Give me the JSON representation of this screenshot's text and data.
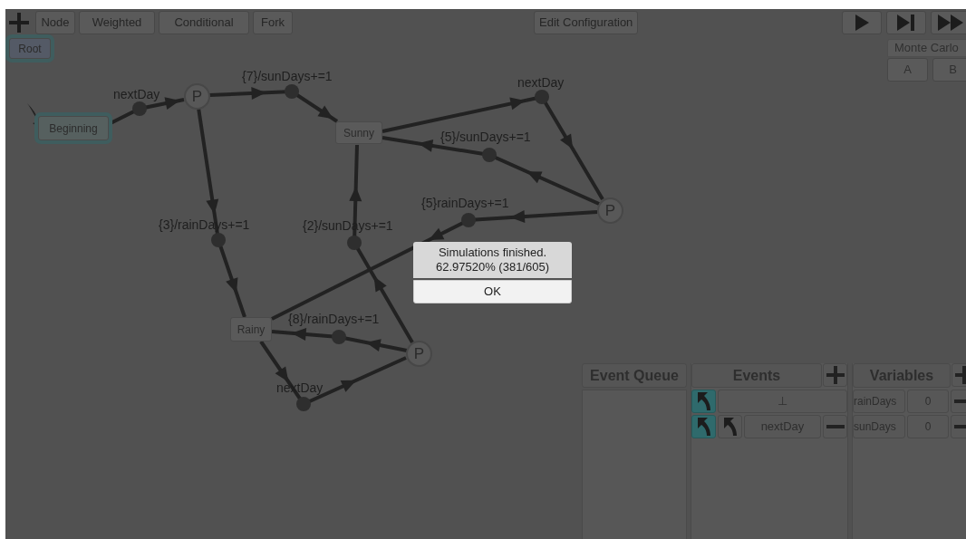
{
  "toolbar": {
    "buttons": [
      "Node",
      "Weighted",
      "Conditional",
      "Fork"
    ],
    "edit_button": "Edit Configuration"
  },
  "mode": {
    "label": "Monte Carlo",
    "options": [
      "A",
      "B"
    ]
  },
  "graph": {
    "nodes": [
      {
        "kind": "state",
        "label": "Root",
        "highlighted": true
      },
      {
        "kind": "state",
        "label": "Beginning",
        "highlighted": true
      },
      {
        "kind": "choice",
        "label": "P"
      },
      {
        "kind": "state",
        "label": "Sunny",
        "highlighted": false
      },
      {
        "kind": "choice",
        "label": "P"
      },
      {
        "kind": "state",
        "label": "Rainy",
        "highlighted": false
      },
      {
        "kind": "choice",
        "label": "P"
      }
    ],
    "transitions": [
      {
        "label": "nextDay"
      },
      {
        "label": "{7}/sunDays+=1"
      },
      {
        "label": "nextDay"
      },
      {
        "label": "{5}/sunDays+=1"
      },
      {
        "label": "{5}rainDays+=1"
      },
      {
        "label": "{3}/rainDays+=1"
      },
      {
        "label": "{2}/sunDays+=1"
      },
      {
        "label": "{8}/rainDays+=1"
      },
      {
        "label": "nextDay"
      }
    ]
  },
  "dialog": {
    "message": [
      "Simulations finished.",
      "62.97520% (381/605)"
    ],
    "button": "OK"
  },
  "event_queue": {
    "title": "Event Queue"
  },
  "events": {
    "title": "Events",
    "rows": [
      {
        "label": "⊥",
        "toggles": [
          {
            "on": true
          }
        ],
        "removable": false
      },
      {
        "label": "nextDay",
        "toggles": [
          {
            "on": true
          },
          {
            "on": false
          }
        ],
        "removable": true
      }
    ]
  },
  "variables": {
    "title": "Variables",
    "rows": [
      {
        "name": "rainDays",
        "value": "0"
      },
      {
        "name": "sunDays",
        "value": "0"
      }
    ]
  }
}
